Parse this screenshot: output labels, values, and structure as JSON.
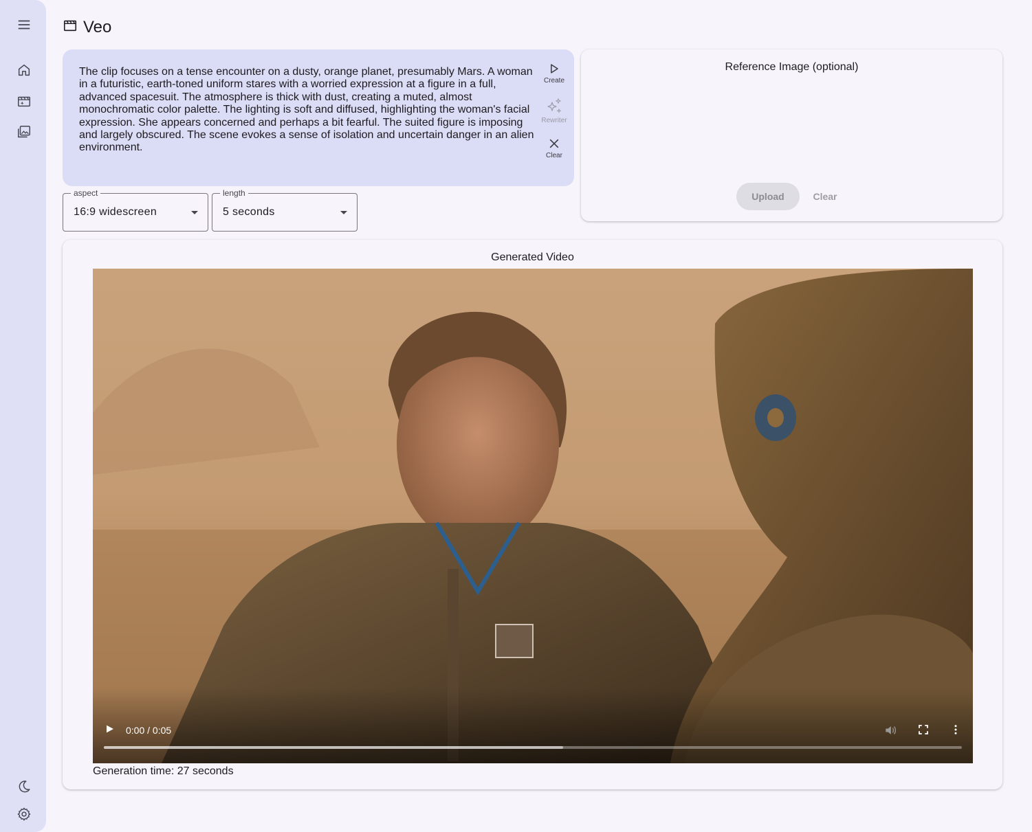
{
  "app": {
    "title": "Veo"
  },
  "sidebar": {
    "items": [
      {
        "icon": "menu-icon"
      },
      {
        "icon": "home-icon"
      },
      {
        "icon": "movie-icon"
      },
      {
        "icon": "photo-library-icon"
      }
    ],
    "bottom": [
      {
        "icon": "dark-mode-icon"
      },
      {
        "icon": "settings-icon"
      }
    ]
  },
  "prompt": {
    "text": "The clip focuses on a tense encounter on a dusty, orange planet, presumably Mars. A woman in a futuristic, earth-toned uniform stares with a worried expression at a figure in a full, advanced spacesuit. The atmosphere is thick with dust, creating a muted, almost monochromatic color palette. The lighting is soft and diffused, highlighting the woman's facial expression. She appears concerned and perhaps a bit fearful. The suited figure is imposing and largely obscured. The scene evokes a sense of isolation and uncertain danger in an alien environment.",
    "actions": {
      "create": "Create",
      "rewriter": "Rewriter",
      "clear": "Clear"
    }
  },
  "controls": {
    "aspect": {
      "label": "aspect",
      "value": "16:9 widescreen"
    },
    "length": {
      "label": "length",
      "value": "5 seconds"
    }
  },
  "reference": {
    "title": "Reference Image (optional)",
    "upload_label": "Upload",
    "clear_label": "Clear"
  },
  "video": {
    "title": "Generated Video",
    "time": "0:00 / 0:05",
    "progress_fraction": 0.535,
    "generation_time": "Generation time: 27 seconds"
  },
  "colors": {
    "sidebar_bg": "#dfe0f6",
    "prompt_bg": "#dbdcf5",
    "page_bg": "#f7f5fb"
  }
}
